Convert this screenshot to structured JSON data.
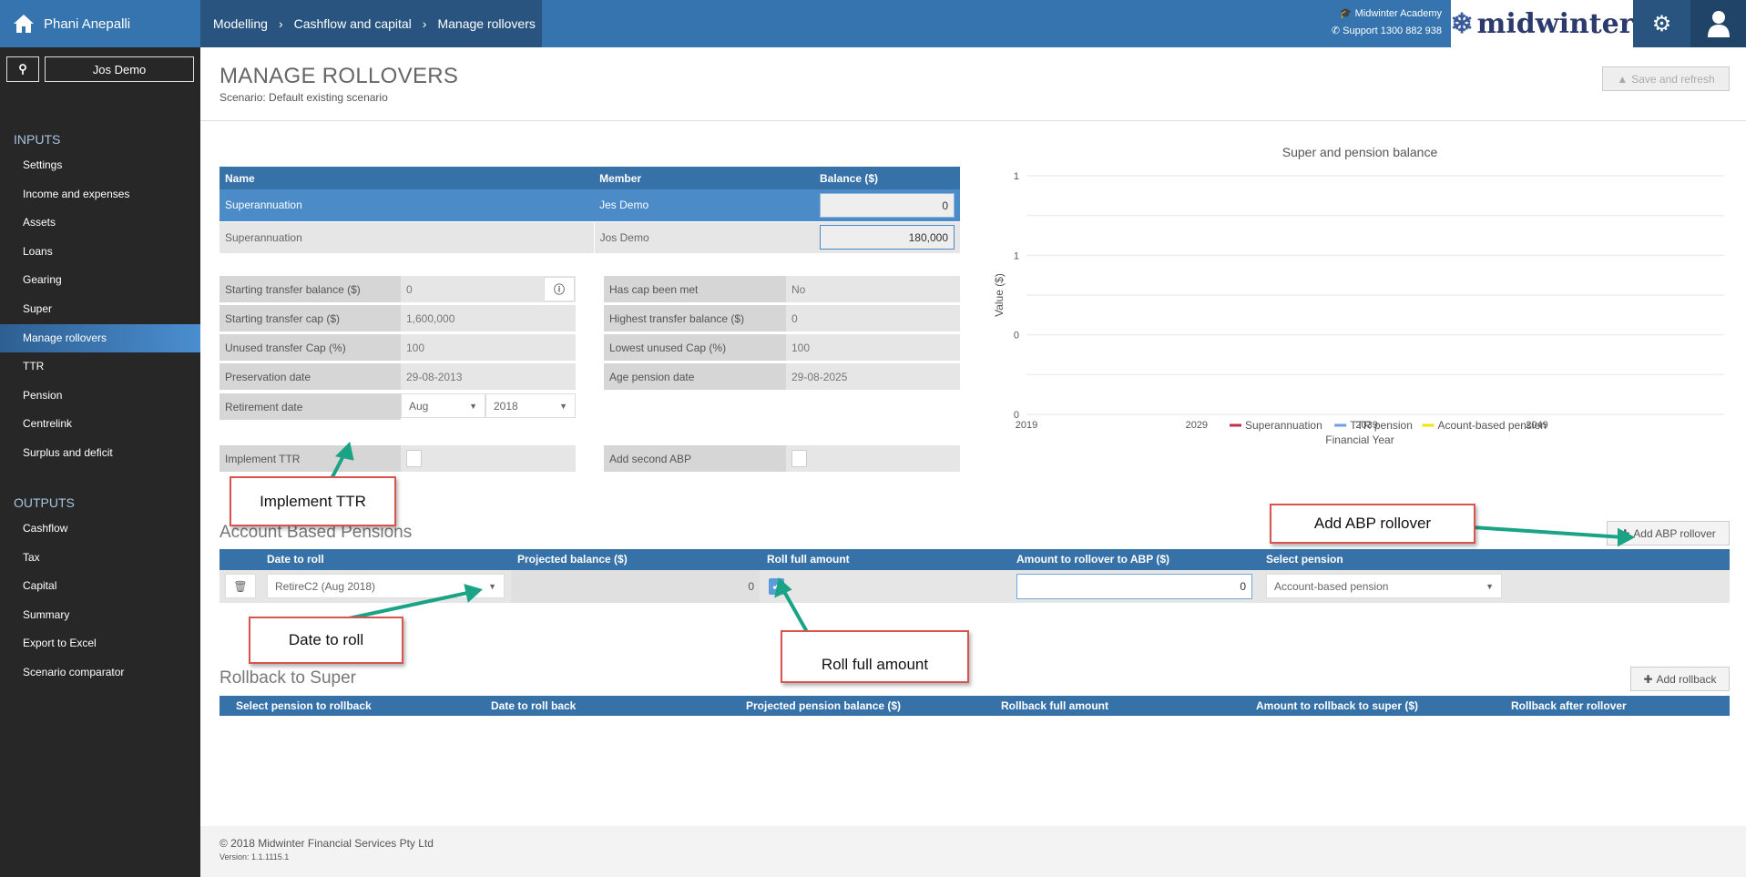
{
  "header": {
    "user_name": "Phani Anepalli",
    "breadcrumb": [
      "Modelling",
      "Cashflow and capital",
      "Manage rollovers"
    ],
    "academy": "Midwinter Academy",
    "support": "Support 1300 882 938",
    "logo_text": "midwinter"
  },
  "sidebar": {
    "search_client": "Jos Demo",
    "inputs_title": "INPUTS",
    "inputs": [
      "Settings",
      "Income and expenses",
      "Assets",
      "Loans",
      "Gearing",
      "Super",
      "Manage rollovers",
      "TTR",
      "Pension",
      "Centrelink",
      "Surplus and deficit"
    ],
    "active": "Manage rollovers",
    "outputs_title": "OUTPUTS",
    "outputs": [
      "Cashflow",
      "Tax",
      "Capital",
      "Summary",
      "Export to Excel",
      "Scenario comparator"
    ]
  },
  "page": {
    "title": "MANAGE ROLLOVERS",
    "scenario": "Scenario: Default existing scenario",
    "save_label": "Save and refresh"
  },
  "balances": {
    "headers": [
      "Name",
      "Member",
      "Balance ($)"
    ],
    "rows": [
      {
        "name": "Superannuation",
        "member": "Jes Demo",
        "balance": "0"
      },
      {
        "name": "Superannuation",
        "member": "Jos Demo",
        "balance": "180,000"
      }
    ]
  },
  "fields_left": [
    {
      "label": "Starting transfer balance ($)",
      "value": "0"
    },
    {
      "label": "Starting transfer cap ($)",
      "value": "1,600,000"
    },
    {
      "label": "Unused transfer Cap (%)",
      "value": "100"
    },
    {
      "label": "Preservation date",
      "value": "29-08-2013"
    }
  ],
  "retirement": {
    "label": "Retirement date",
    "month": "Aug",
    "year": "2018"
  },
  "fields_right": [
    {
      "label": "Has cap been met",
      "value": "No"
    },
    {
      "label": "Highest transfer balance ($)",
      "value": "0"
    },
    {
      "label": "Lowest unused Cap (%)",
      "value": "100"
    },
    {
      "label": "Age pension date",
      "value": "29-08-2025"
    }
  ],
  "toggles": {
    "ttr_label": "Implement TTR",
    "ttr_checked": false,
    "abp2_label": "Add second ABP",
    "abp2_checked": false
  },
  "chart_data": {
    "type": "line",
    "title": "Super and pension balance",
    "xlabel": "Financial Year",
    "ylabel": "Value ($)",
    "xticks": [
      "2019",
      "2029",
      "2039",
      "2049"
    ],
    "xlim": [
      2019,
      2060
    ],
    "yticks": [
      "1",
      "1",
      "0",
      "0"
    ],
    "ylim": [
      0,
      1
    ],
    "grid": true,
    "legend_position": "bottom",
    "series": [
      {
        "name": "Superannuation",
        "color": "#c0314a",
        "values": []
      },
      {
        "name": "TTR pension",
        "color": "#6f9ce8",
        "values": []
      },
      {
        "name": "Acount-based pension",
        "color": "#f0e600",
        "values": []
      }
    ]
  },
  "abp": {
    "title": "Account Based Pensions",
    "add_label": "Add ABP rollover",
    "headers": [
      "Date to roll",
      "Projected balance ($)",
      "Roll full amount",
      "Amount to rollover to ABP ($)",
      "Select pension"
    ],
    "row": {
      "date": "RetireC2 (Aug 2018)",
      "projected": "0",
      "roll_full": true,
      "amount": "0",
      "pension": "Account-based pension"
    }
  },
  "rollback": {
    "title": "Rollback to Super",
    "add_label": "Add rollback",
    "headers": [
      "Select pension to rollback",
      "Date to roll back",
      "Projected pension balance ($)",
      "Rollback full amount",
      "Amount to rollback to super ($)",
      "Rollback after rollover"
    ]
  },
  "annotations": [
    "Implement TTR",
    "Add ABP rollover",
    "Date to roll",
    "Roll full amount"
  ],
  "footer": {
    "copyright": "© 2018 Midwinter Financial Services Pty Ltd",
    "version": "Version: 1.1.1115.1"
  }
}
